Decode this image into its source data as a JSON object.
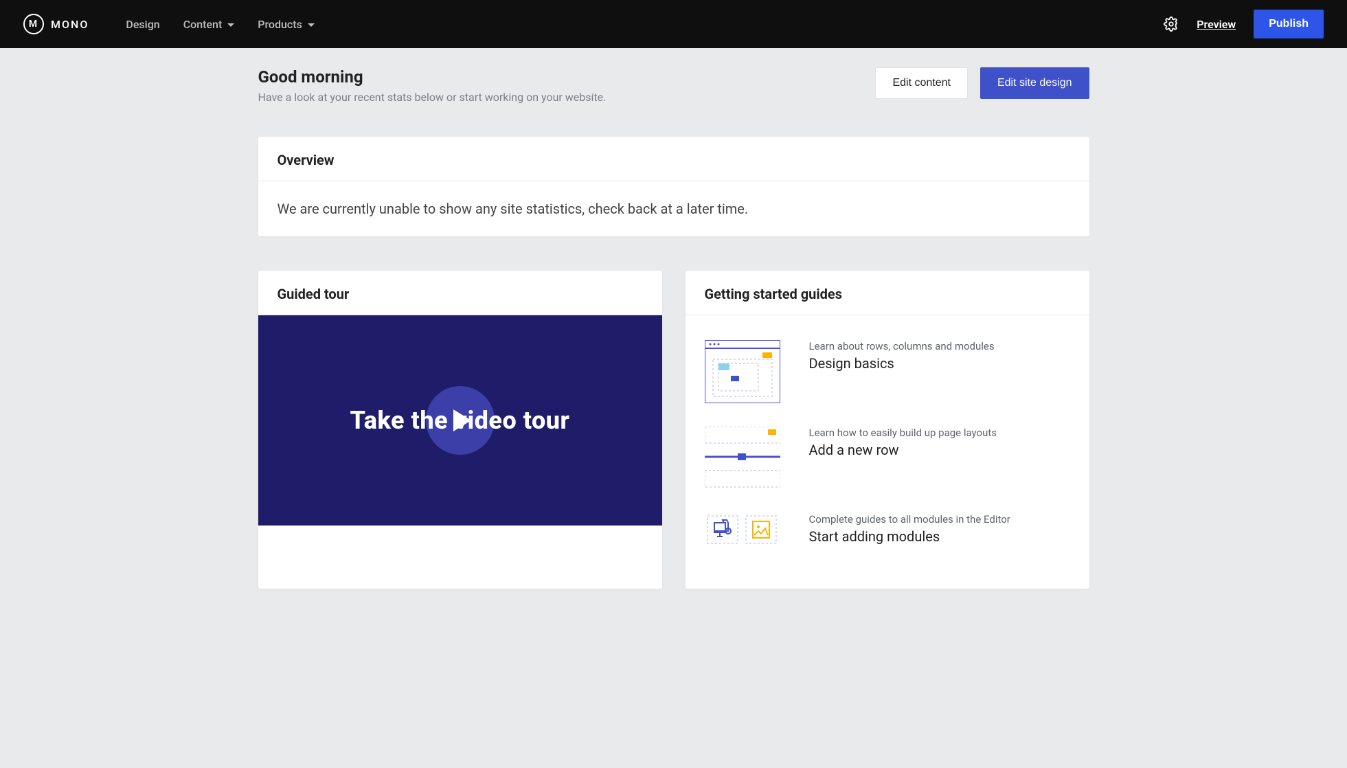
{
  "header": {
    "brand": "MONO",
    "nav": {
      "design": "Design",
      "content": "Content",
      "products": "Products"
    },
    "preview": "Preview",
    "publish": "Publish"
  },
  "hero": {
    "greeting": "Good morning",
    "subtitle": "Have a look at your recent stats below or start working on your website.",
    "edit_content": "Edit content",
    "edit_design": "Edit site design"
  },
  "overview": {
    "title": "Overview",
    "message": "We are currently unable to show any site statistics, check back at a later time."
  },
  "tour": {
    "title": "Guided tour",
    "overlay_text": "Take the video tour"
  },
  "guides": {
    "title": "Getting started guides",
    "items": [
      {
        "kicker": "Learn about rows, columns and modules",
        "title": "Design basics"
      },
      {
        "kicker": "Learn how to easily build up page layouts",
        "title": "Add a new row"
      },
      {
        "kicker": "Complete guides to all modules in the Editor",
        "title": "Start adding modules"
      }
    ]
  }
}
